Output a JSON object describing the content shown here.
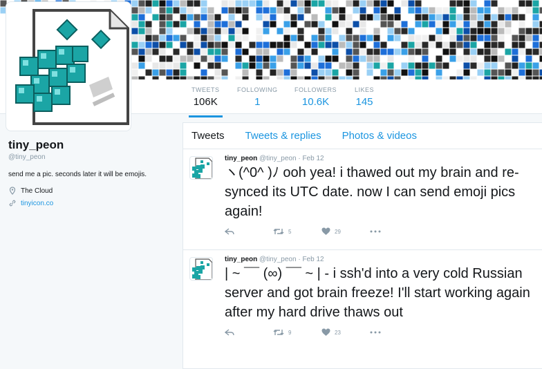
{
  "profile": {
    "name": "tiny_peon",
    "handle": "@tiny_peon",
    "bio": "send me a pic. seconds later it will be emojis.",
    "location": "The Cloud",
    "website": "tinyicon.co"
  },
  "stats": [
    {
      "label": "TWEETS",
      "value": "106K"
    },
    {
      "label": "FOLLOWING",
      "value": "1"
    },
    {
      "label": "FOLLOWERS",
      "value": "10.6K"
    },
    {
      "label": "LIKES",
      "value": "145"
    }
  ],
  "tabs": [
    "Tweets",
    "Tweets & replies",
    "Photos & videos"
  ],
  "tweets": [
    {
      "name": "tiny_peon",
      "handle": "@tiny_peon",
      "date": "Feb 12",
      "text": "ヽ(^0^ )ﾉ ooh yea! i thawed out my brain and re-synced its UTC date. now I can send emoji pics again!",
      "retweets": "5",
      "likes": "29"
    },
    {
      "name": "tiny_peon",
      "handle": "@tiny_peon",
      "date": "Feb 12",
      "text": "| ~ ¯¯ (∞) ¯¯ ~ | - i ssh'd into a very cold Russian server and got brain freeze! I'll start working again after my hard drive thaws out",
      "retweets": "9",
      "likes": "23"
    }
  ],
  "icons": {
    "location": "map-pin-icon",
    "website": "link-icon",
    "reply": "reply-icon",
    "retweet": "retweet-icon",
    "like": "heart-icon",
    "more": "more-dots-icon"
  },
  "colors": {
    "accent": "#1b95e0",
    "muted": "#8899a6",
    "background": "#f5f8fa",
    "avatar_teal": "#1ba5a5"
  }
}
